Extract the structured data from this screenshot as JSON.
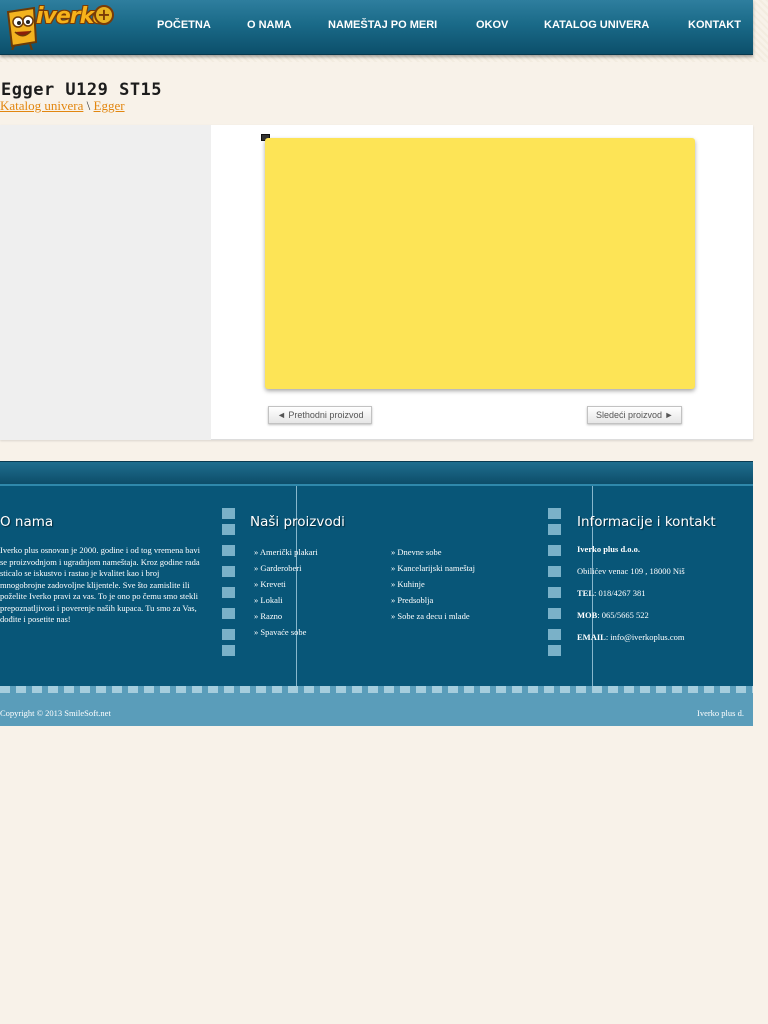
{
  "brand": {
    "logo_text": "iverko",
    "logo_plus": "+"
  },
  "nav": {
    "items": [
      {
        "label": "POČETNA"
      },
      {
        "label": "O NAMA"
      },
      {
        "label": "NAMEŠTAJ PO MERI"
      },
      {
        "label": "OKOV"
      },
      {
        "label": "KATALOG UNIVERA"
      },
      {
        "label": "KONTAKT"
      }
    ]
  },
  "page": {
    "title": "Egger U129 ST15",
    "breadcrumb": [
      {
        "label": "Katalog univera"
      },
      {
        "label": "Egger"
      }
    ],
    "separator": "\\"
  },
  "product": {
    "swatch_color": "#fde456",
    "prev_label": "◄ Prethodni proizvod",
    "next_label": "Sledeći proizvod ►"
  },
  "footer": {
    "about": {
      "heading": "O nama",
      "text": "Iverko plus osnovan je 2000. godine i od tog vremena bavi se proizvodnjom i ugradnjom nameštaja. Kroz godine rada sticalo se iskustvo i rastao je kvalitet kao i broj mnogobrojne zadovoljne klijentele. Sve što zamislite ili poželite Iverko pravi za vas. To je ono po čemu smo stekli prepoznatljivost i poverenje naših kupaca. Tu smo za Vas, dođite i posetite nas!"
    },
    "products": {
      "heading": "Naši proizvodi",
      "col1": [
        "» Američki plakari",
        "» Garderoberi",
        "» Kreveti",
        "» Lokali",
        "» Razno",
        "» Spavaće sobe"
      ],
      "col2": [
        "» Dnevne sobe",
        "» Kancelarijski nameštaj",
        "» Kuhinje",
        "» Predsoblja",
        "» Sobe za decu i mlade"
      ]
    },
    "contact": {
      "heading": "Informacije i kontakt",
      "company": "Iverko plus d.o.o.",
      "address": "Obilićev venac 109 , 18000 Niš",
      "tel_label": "TEL",
      "tel": ": 018/4267 381",
      "mob_label": "MOB",
      "mob": ": 065/5665 522",
      "email_label": "EMAIL",
      "email": ": info@iverkoplus.com"
    },
    "copyright": "Copyright © 2013  SmileSoft.net",
    "copyright_right": "Iverko plus d."
  },
  "colors": {
    "nav": "#1a6a88",
    "footer": "#085678",
    "accent_link": "#e2860f"
  }
}
